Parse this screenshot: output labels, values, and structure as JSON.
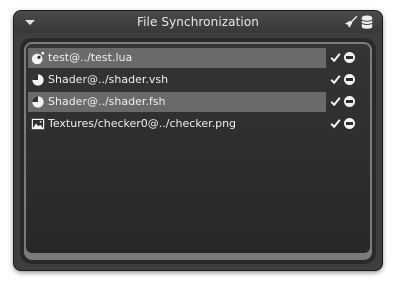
{
  "window": {
    "title": "File Synchronization"
  },
  "icons": {
    "collapse": "triangle-down-icon",
    "clear": "broom-icon",
    "save": "disk-icon",
    "check": "checkmark-icon",
    "remove": "minus-circle-icon"
  },
  "files": [
    {
      "label": "test@../test.lua",
      "icon": "lua-script-icon",
      "selected": true
    },
    {
      "label": "Shader@../shader.vsh",
      "icon": "shader-icon",
      "selected": false
    },
    {
      "label": "Shader@../shader.fsh",
      "icon": "shader-icon",
      "selected": true
    },
    {
      "label": "Textures/checker0@../checker.png",
      "icon": "image-icon",
      "selected": false
    }
  ],
  "colors": {
    "window_bg": "#3e3e3e",
    "selected_row": "#6a6a6a",
    "text": "#f0f0f0"
  }
}
